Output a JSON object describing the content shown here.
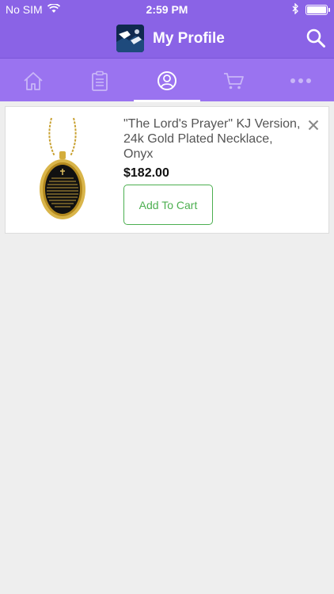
{
  "status_bar": {
    "carrier": "No SIM",
    "time": "2:59 PM"
  },
  "header": {
    "title": "My Profile",
    "logo_icon": "app-logo",
    "search_icon": "search-icon"
  },
  "tabs": [
    {
      "name": "home",
      "icon": "home-icon",
      "active": false
    },
    {
      "name": "orders",
      "icon": "clipboard-icon",
      "active": false
    },
    {
      "name": "profile",
      "icon": "user-circle-icon",
      "active": true
    },
    {
      "name": "cart",
      "icon": "cart-icon",
      "active": false
    },
    {
      "name": "more",
      "icon": "more-icon",
      "active": false
    }
  ],
  "wishlist": {
    "items": [
      {
        "title": "\"The Lord's Prayer\" KJ Version, 24k Gold Plated Necklace, Onyx",
        "price": "$182.00",
        "add_to_cart_label": "Add To Cart"
      }
    ]
  },
  "colors": {
    "primary": "#8a63e6",
    "tab_bar": "#9a73f0",
    "accent_green": "#4caf50"
  }
}
